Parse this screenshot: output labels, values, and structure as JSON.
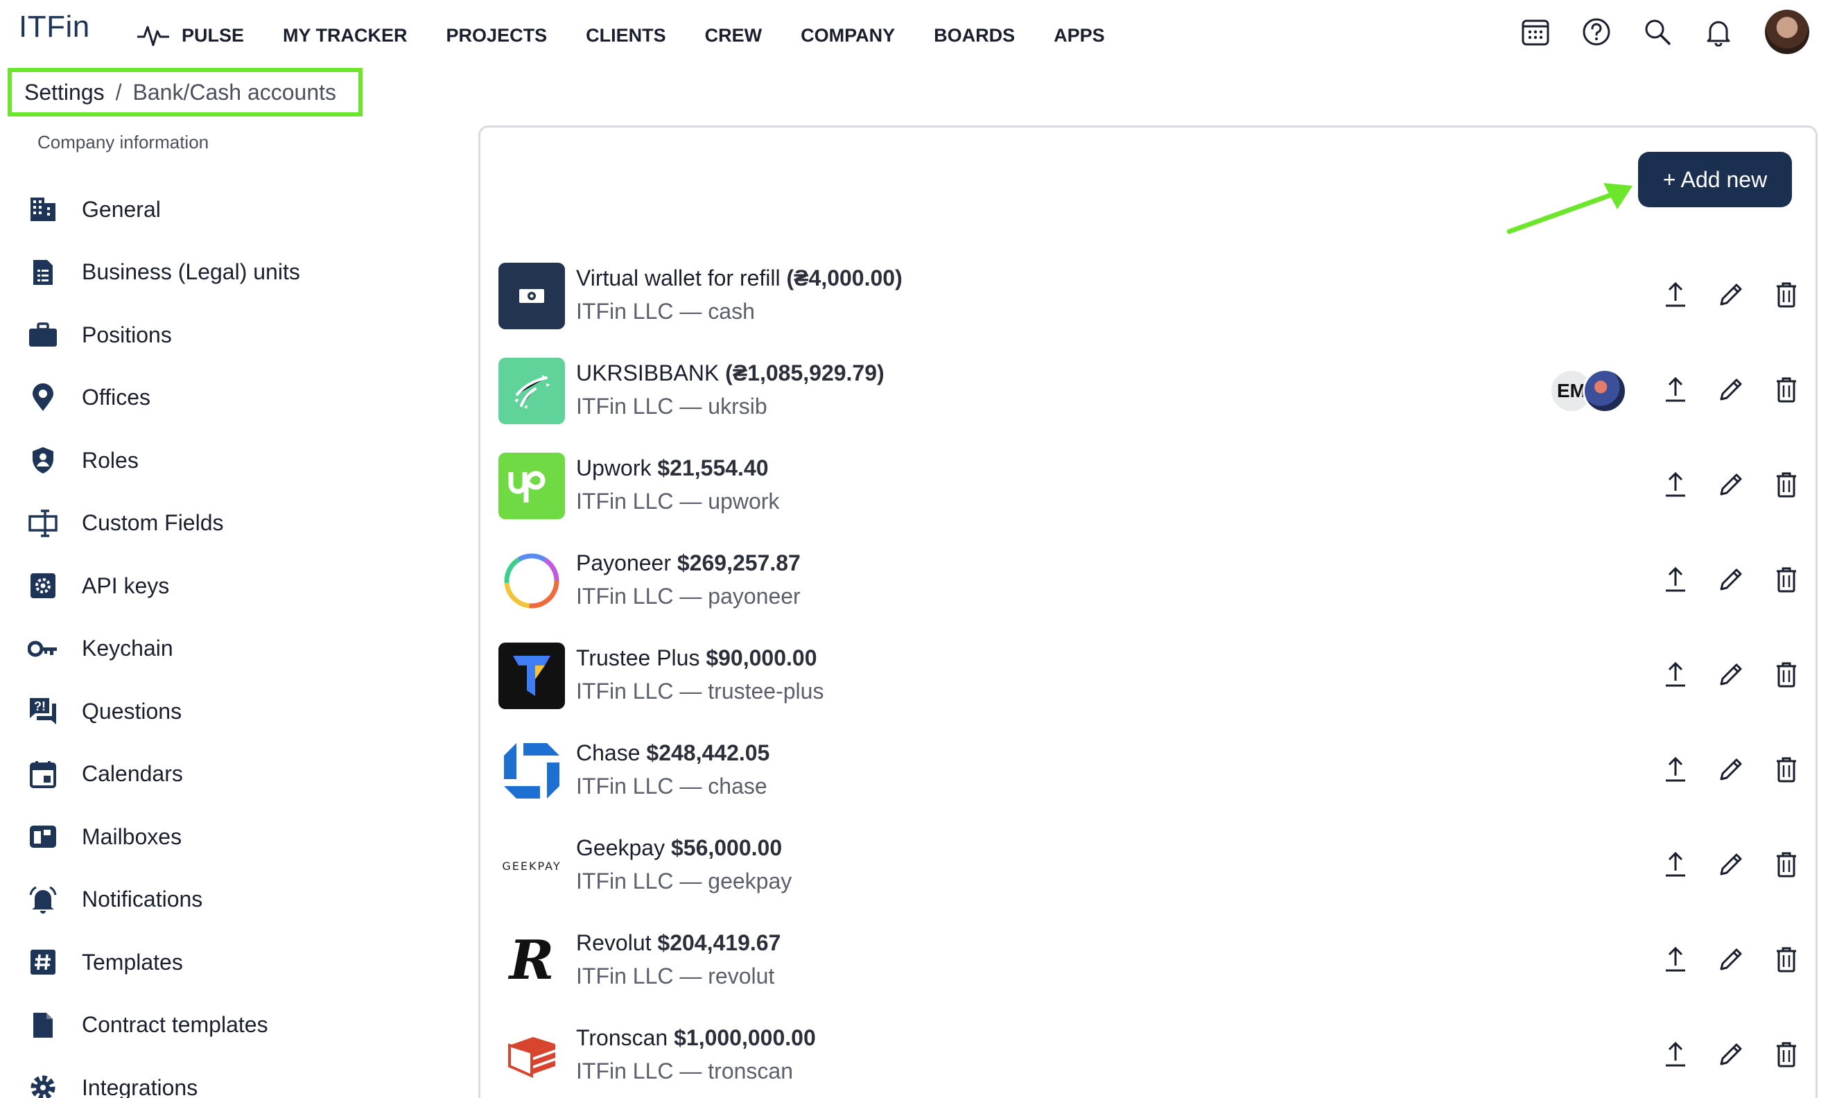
{
  "brand": {
    "logo": "ITFin"
  },
  "nav": {
    "items": [
      {
        "label": "PULSE",
        "icon": "pulse-icon"
      },
      {
        "label": "MY TRACKER"
      },
      {
        "label": "PROJECTS"
      },
      {
        "label": "CLIENTS"
      },
      {
        "label": "CREW"
      },
      {
        "label": "COMPANY"
      },
      {
        "label": "BOARDS"
      },
      {
        "label": "APPS"
      }
    ],
    "right_icons": [
      "calendar-grid-icon",
      "help-icon",
      "search-icon",
      "bell-icon",
      "user-avatar"
    ]
  },
  "breadcrumb": {
    "root": "Settings",
    "separator": "/",
    "current": "Bank/Cash accounts"
  },
  "sidebar": {
    "section": "Company information",
    "items": [
      {
        "label": "General",
        "icon": "building-icon"
      },
      {
        "label": "Business (Legal) units",
        "icon": "document-icon"
      },
      {
        "label": "Positions",
        "icon": "briefcase-icon"
      },
      {
        "label": "Offices",
        "icon": "location-pin-icon"
      },
      {
        "label": "Roles",
        "icon": "shield-user-icon"
      },
      {
        "label": "Custom Fields",
        "icon": "form-field-icon"
      },
      {
        "label": "API keys",
        "icon": "api-gear-icon"
      },
      {
        "label": "Keychain",
        "icon": "key-icon"
      },
      {
        "label": "Questions",
        "icon": "question-chat-icon"
      },
      {
        "label": "Calendars",
        "icon": "calendar-icon"
      },
      {
        "label": "Mailboxes",
        "icon": "mailbox-icon"
      },
      {
        "label": "Notifications",
        "icon": "bell-ring-icon"
      },
      {
        "label": "Templates",
        "icon": "hashtag-icon"
      },
      {
        "label": "Contract templates",
        "icon": "file-icon"
      },
      {
        "label": "Integrations",
        "icon": "settings-icon"
      }
    ]
  },
  "main": {
    "add_button": "+ Add new",
    "accounts": [
      {
        "name": "Virtual wallet for refill",
        "amount": "(₴4,000.00)",
        "sub": "ITFin LLC — cash",
        "logo": "cash-logo"
      },
      {
        "name": "UKRSIBBANK",
        "amount": "(₴1,085,929.79)",
        "sub": "ITFin LLC — ukrsib",
        "logo": "ukrsib-logo",
        "members": [
          "EM"
        ]
      },
      {
        "name": "Upwork",
        "amount": "$21,554.40",
        "sub": "ITFin LLC — upwork",
        "logo": "upwork-logo"
      },
      {
        "name": "Payoneer",
        "amount": "$269,257.87",
        "sub": "ITFin LLC — payoneer",
        "logo": "payoneer-logo"
      },
      {
        "name": "Trustee Plus",
        "amount": "$90,000.00",
        "sub": "ITFin LLC — trustee-plus",
        "logo": "trustee-logo"
      },
      {
        "name": "Chase",
        "amount": "$248,442.05",
        "sub": "ITFin LLC — chase",
        "logo": "chase-logo"
      },
      {
        "name": "Geekpay",
        "amount": "$56,000.00",
        "sub": "ITFin LLC — geekpay",
        "logo": "geekpay-logo",
        "logo_text": "GEEKPAY"
      },
      {
        "name": "Revolut",
        "amount": "$204,419.67",
        "sub": "ITFin LLC — revolut",
        "logo": "revolut-logo",
        "logo_text": "R"
      },
      {
        "name": "Tronscan",
        "amount": "$1,000,000.00",
        "sub": "ITFin LLC — tronscan",
        "logo": "tronscan-logo"
      }
    ]
  },
  "colors": {
    "primary": "#1b3050",
    "highlight": "#6be62a",
    "text": "#1a1f2e"
  }
}
